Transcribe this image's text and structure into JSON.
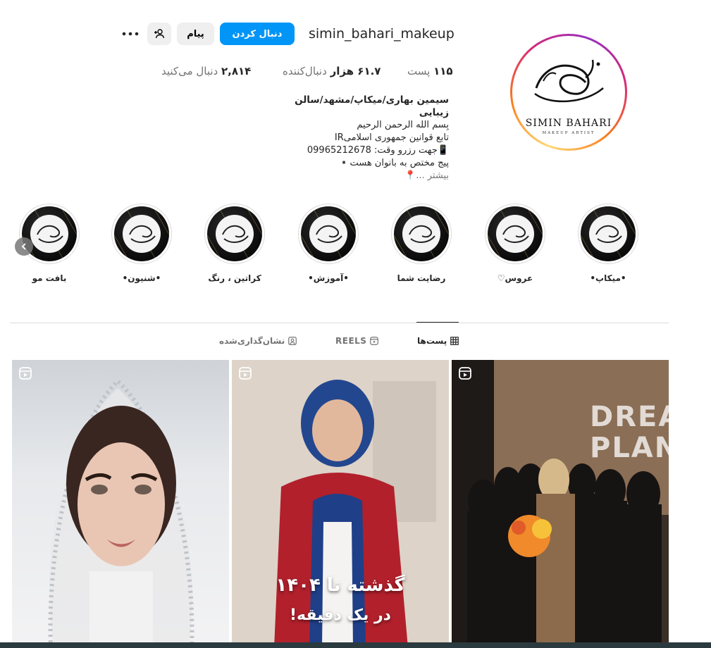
{
  "profile": {
    "username": "simin_bahari_makeup",
    "follow_label": "دنبال کردن",
    "message_label": "پیام",
    "logo_name": "SIMIN BAHARI",
    "logo_sub": "MAKEUP ARTIST"
  },
  "stats": {
    "posts_value": "۱۱۵",
    "posts_label": "پست",
    "followers_value": "۶۱.۷ هزار",
    "followers_label": "دنبال‌کننده",
    "following_value": "۲,۸۱۴",
    "following_label": "دنبال می‌کنید"
  },
  "bio": {
    "name": "سیمین بهاری/میکاپ/مشهد/سالن زیبایی",
    "line1": "بِسم الله الرحمن الرحیم",
    "line2": "تابع قوانین جمهوری اسلامیIR",
    "line3": "📱جهت رزرو وقت: 09965212678",
    "line4": "پیج مختص به بانوان هست▪️",
    "more": "بیشتر ...📍"
  },
  "highlights": [
    {
      "label": "•میکاپ•"
    },
    {
      "label": "عروس♡"
    },
    {
      "label": "رضایت شما"
    },
    {
      "label": "•آموزش•"
    },
    {
      "label": "کراتین ، رنگ"
    },
    {
      "label": "•شنیون•"
    },
    {
      "label": "بافت مو"
    }
  ],
  "tabs": {
    "posts": "پست‌ها",
    "reels": "REELS",
    "tagged": "نشان‌گذاری‌شده"
  },
  "posts": {
    "post2_caption_1": "گذشته تا ۱۴۰۴",
    "post2_caption_2": "در یک دقیقه!",
    "post3_wall_1": "DREAM",
    "post3_wall_2": "PLAN"
  },
  "colors": {
    "accent": "#0095f6",
    "secondary_button": "#efefef",
    "muted_text": "#737373"
  }
}
